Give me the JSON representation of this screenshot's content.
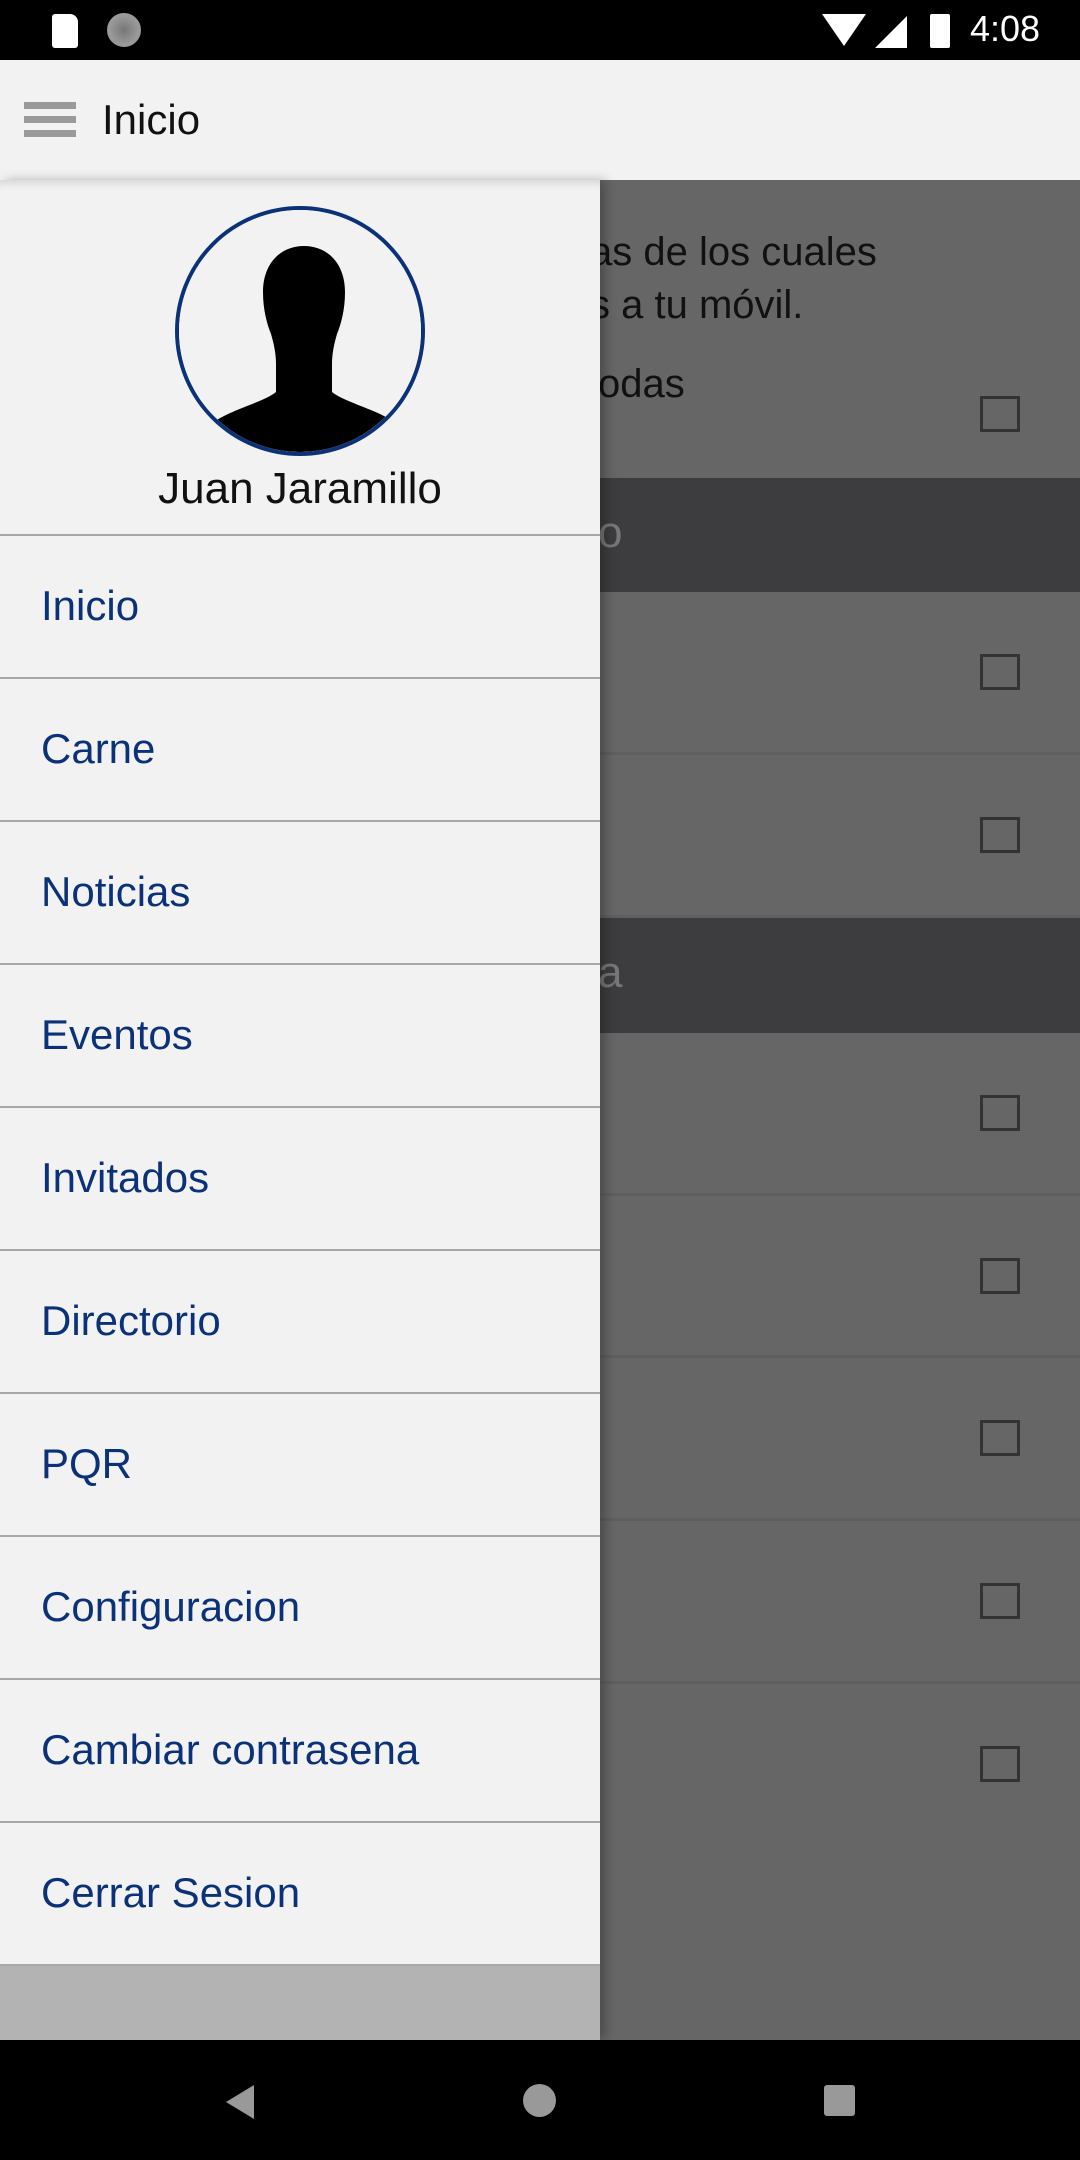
{
  "status_bar": {
    "time": "4:08",
    "icons": [
      "sd-card-icon",
      "loading-icon",
      "wifi-icon",
      "cell-signal-icon",
      "battery-icon"
    ]
  },
  "app_bar": {
    "title": "Inicio",
    "menu_icon": "hamburger-menu-icon"
  },
  "background": {
    "intro_line1": "as de los cuales",
    "intro_line2": "s a tu móvil.",
    "select_all": "odas",
    "section1": "o",
    "section2": "a"
  },
  "drawer": {
    "user_name": "Juan Jaramillo",
    "items": [
      {
        "label": "Inicio"
      },
      {
        "label": "Carne"
      },
      {
        "label": "Noticias"
      },
      {
        "label": "Eventos"
      },
      {
        "label": "Invitados"
      },
      {
        "label": "Directorio"
      },
      {
        "label": "PQR"
      },
      {
        "label": "Configuracion"
      },
      {
        "label": "Cambiar contrasena"
      },
      {
        "label": "Cerrar Sesion"
      }
    ]
  },
  "colors": {
    "accent": "#0b3278",
    "overlay": "#666666",
    "section": "#3d3d3f"
  }
}
